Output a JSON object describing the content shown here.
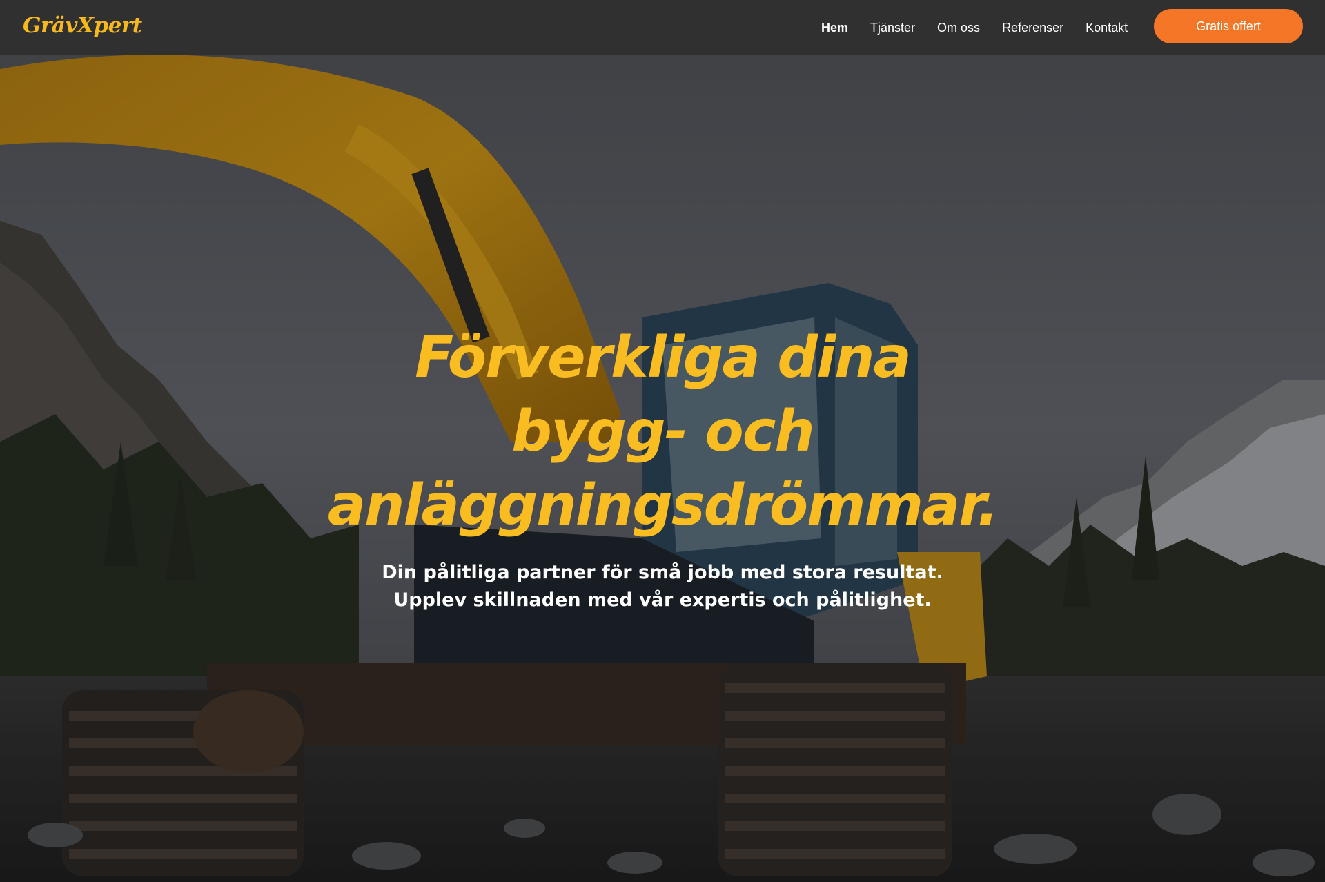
{
  "brand": {
    "logo_text": "GrävXpert"
  },
  "nav": {
    "items": [
      {
        "label": "Hem",
        "active": true
      },
      {
        "label": "Tjänster",
        "active": false
      },
      {
        "label": "Om oss",
        "active": false
      },
      {
        "label": "Referenser",
        "active": false
      },
      {
        "label": "Kontakt",
        "active": false
      }
    ],
    "cta_label": "Gratis offert"
  },
  "hero": {
    "headline_lines": [
      "Förverkliga dina",
      "bygg- och",
      "anläggningsdrömmar."
    ],
    "subline_lines": [
      "Din pålitliga partner för små jobb med stora resultat.",
      "Upplev skillnaden med vår expertis och pålitlighet."
    ]
  },
  "colors": {
    "navbar": "#303030",
    "brand_yellow": "#f9bd21",
    "cta_orange": "#f47626",
    "text_white": "#ffffff"
  }
}
